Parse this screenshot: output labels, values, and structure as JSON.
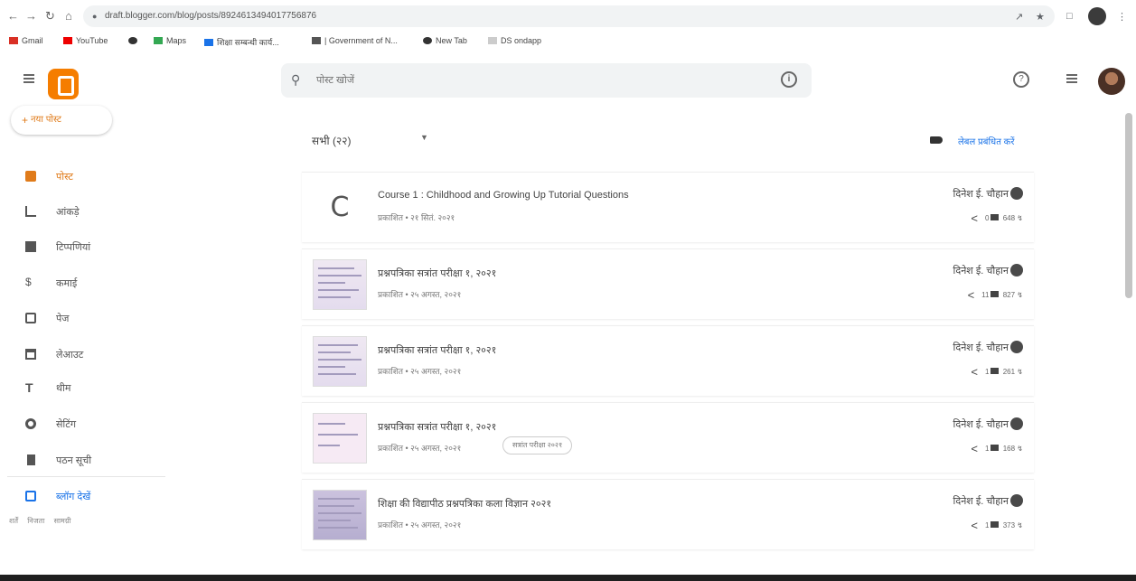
{
  "browser": {
    "url": "draft.blogger.com/blog/posts/8924613494017756876",
    "bookmarks": [
      "Gmail",
      "YouTube",
      "",
      "Maps",
      "शिक्षा सम्बन्धी कार्य...",
      "| Government of N...",
      "New Tab",
      "DS ondapp"
    ]
  },
  "header": {
    "search_placeholder": "पोस्ट खोजें"
  },
  "sidebar": {
    "new_post": "नया पोस्ट",
    "items": [
      {
        "label": "पोस्ट",
        "icon": "posts-icon"
      },
      {
        "label": "आंकड़े",
        "icon": "stats-icon"
      },
      {
        "label": "टिप्पणियां",
        "icon": "comments-icon"
      },
      {
        "label": "कमाई",
        "icon": "earnings-icon"
      },
      {
        "label": "पेज",
        "icon": "pages-icon"
      },
      {
        "label": "लेआउट",
        "icon": "layout-icon"
      },
      {
        "label": "थीम",
        "icon": "theme-icon"
      },
      {
        "label": "सेटिंग",
        "icon": "settings-icon"
      },
      {
        "label": "पठन सूची",
        "icon": "reading-list-icon"
      },
      {
        "label": "ब्लॉग देखें",
        "icon": "view-blog-icon"
      }
    ],
    "footer": [
      "शर्तें",
      "निजता",
      "सामग्री"
    ]
  },
  "main": {
    "filter_label": "सभी (२२)",
    "manage_labels": "लेबल प्रबंधित करें",
    "posts": [
      {
        "title": "Course 1 : Childhood and Growing Up Tutorial Questions",
        "meta": "प्रकाशित • २१ सितं. २०२१",
        "author": "दिनेश ई. चौहान",
        "comments": "0",
        "views": "648",
        "thumb": "C",
        "chip": ""
      },
      {
        "title": "प्रश्नपत्रिका सत्रांत परीक्षा १, २०२१",
        "meta": "प्रकाशित • २५ अगस्त, २०२१",
        "author": "दिनेश ई. चौहान",
        "comments": "11",
        "views": "827",
        "thumb": "doc",
        "chip": ""
      },
      {
        "title": "प्रश्नपत्रिका सत्रांत परीक्षा १, २०२१",
        "meta": "प्रकाशित • २५ अगस्त, २०२१",
        "author": "दिनेश ई. चौहान",
        "comments": "1",
        "views": "261",
        "thumb": "doc",
        "chip": ""
      },
      {
        "title": "प्रश्नपत्रिका सत्रांत परीक्षा १, २०२१",
        "meta": "प्रकाशित • २५ अगस्त, २०२१",
        "author": "दिनेश ई. चौहान",
        "comments": "1",
        "views": "168",
        "thumb": "pink",
        "chip": "सत्रांत परीक्षा २०२१"
      },
      {
        "title": "शिक्षा की विद्यापीठ प्रश्नपत्रिका कला विज्ञान २०२१",
        "meta": "प्रकाशित • २५ अगस्त, २०२१",
        "author": "दिनेश ई. चौहान",
        "comments": "1",
        "views": "373",
        "thumb": "dark",
        "chip": ""
      }
    ]
  }
}
